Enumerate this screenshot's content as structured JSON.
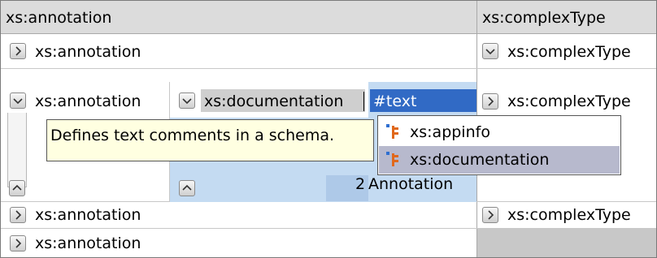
{
  "headers": {
    "col1": "xs:annotation",
    "col2": "xs:complexType"
  },
  "rows": [
    {
      "col1": "xs:annotation",
      "col2": "xs:complexType"
    },
    {
      "col1": "xs:annotation",
      "col2": "xs:complexType"
    },
    {
      "col1": "xs:annotation",
      "col2": "xs:complexType"
    },
    {
      "col1": "xs:annotation"
    }
  ],
  "nested": {
    "element": "xs:documentation",
    "text_cell": "#text",
    "row_index": "2",
    "row_text": "Annotation"
  },
  "tooltip": {
    "text": "Defines text comments in a schema."
  },
  "popup": {
    "items": [
      {
        "label": "xs:appinfo",
        "icon": "element-icon"
      },
      {
        "label": "xs:documentation",
        "icon": "element-icon",
        "selected": true
      }
    ]
  },
  "colors": {
    "header_bg": "#dcdcdc",
    "selection_blue": "#316ac5",
    "nested_bg": "#c4dbf2",
    "tooltip_bg": "#ffffe1",
    "popup_selected": "#b7b9cd",
    "icon_orange": "#e0681b",
    "icon_blue": "#2f6fd0"
  }
}
